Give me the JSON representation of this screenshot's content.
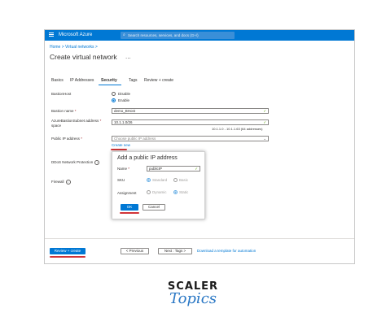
{
  "topbar": {
    "brand": "Microsoft Azure",
    "search_placeholder": "Search resources, services, and docs (G+/)",
    "menu_icon": "hamburger-icon",
    "search_icon": "search-icon"
  },
  "breadcrumb": "Home > Virtual networks >",
  "page": {
    "title": "Create virtual network",
    "more": "..."
  },
  "tabs": [
    {
      "label": "Basics",
      "active": false
    },
    {
      "label": "IP Addresses",
      "active": false
    },
    {
      "label": "Security",
      "active": true
    },
    {
      "label": "Tags",
      "active": false
    },
    {
      "label": "Review + create",
      "active": false
    }
  ],
  "form": {
    "bastion_host_label": "BastionHost",
    "bastion_options": [
      {
        "label": "Disable",
        "selected": false
      },
      {
        "label": "Enable",
        "selected": true
      }
    ],
    "bastion_name_label": "Bastion name",
    "bastion_name_value": "demo_BHost",
    "subnet_label_1": "AzureBastionSubnet address",
    "subnet_label_2": "space",
    "subnet_value": "10.1.1.0/26",
    "subnet_hint": "10.1.1.0 - 10.1.1.63 (64 addresses)",
    "public_ip_label": "Public IP address",
    "public_ip_placeholder": "Choose public IP address",
    "create_new": "Create new",
    "ddos_label": "DDoS Network Protection",
    "firewall_label": "Firewall",
    "required_marker": "*",
    "info_glyph": "i"
  },
  "dialog": {
    "title": "Add a public IP address",
    "name_label": "Name",
    "name_value": "publicIP",
    "sku_label": "SKU",
    "sku_options": [
      {
        "label": "Standard",
        "selected": true
      },
      {
        "label": "Basic",
        "selected": false
      }
    ],
    "assignment_label": "Assignment",
    "assignment_options": [
      {
        "label": "Dynamic",
        "selected": false
      },
      {
        "label": "Static",
        "selected": true
      }
    ],
    "ok_label": "OK",
    "cancel_label": "Cancel"
  },
  "footer": {
    "review_create": "Review + create",
    "previous": "< Previous",
    "next": "Next : Tags >",
    "download_link": "Download a template for automation"
  },
  "watermark": {
    "line1": "SCALER",
    "line2": "Topics"
  },
  "colors": {
    "azure_blue": "#0078d4",
    "annotation_red": "#d13438",
    "valid_green": "#57a300"
  }
}
